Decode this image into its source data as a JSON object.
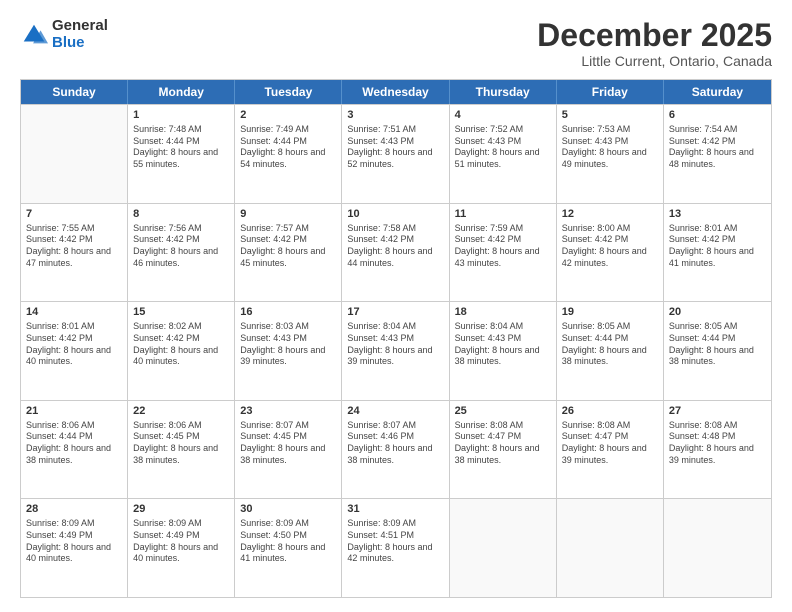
{
  "logo": {
    "general": "General",
    "blue": "Blue"
  },
  "title": {
    "month": "December 2025",
    "location": "Little Current, Ontario, Canada"
  },
  "header_days": [
    "Sunday",
    "Monday",
    "Tuesday",
    "Wednesday",
    "Thursday",
    "Friday",
    "Saturday"
  ],
  "weeks": [
    [
      {
        "day": "",
        "sunrise": "",
        "sunset": "",
        "daylight": ""
      },
      {
        "day": "1",
        "sunrise": "Sunrise: 7:48 AM",
        "sunset": "Sunset: 4:44 PM",
        "daylight": "Daylight: 8 hours and 55 minutes."
      },
      {
        "day": "2",
        "sunrise": "Sunrise: 7:49 AM",
        "sunset": "Sunset: 4:44 PM",
        "daylight": "Daylight: 8 hours and 54 minutes."
      },
      {
        "day": "3",
        "sunrise": "Sunrise: 7:51 AM",
        "sunset": "Sunset: 4:43 PM",
        "daylight": "Daylight: 8 hours and 52 minutes."
      },
      {
        "day": "4",
        "sunrise": "Sunrise: 7:52 AM",
        "sunset": "Sunset: 4:43 PM",
        "daylight": "Daylight: 8 hours and 51 minutes."
      },
      {
        "day": "5",
        "sunrise": "Sunrise: 7:53 AM",
        "sunset": "Sunset: 4:43 PM",
        "daylight": "Daylight: 8 hours and 49 minutes."
      },
      {
        "day": "6",
        "sunrise": "Sunrise: 7:54 AM",
        "sunset": "Sunset: 4:42 PM",
        "daylight": "Daylight: 8 hours and 48 minutes."
      }
    ],
    [
      {
        "day": "7",
        "sunrise": "Sunrise: 7:55 AM",
        "sunset": "Sunset: 4:42 PM",
        "daylight": "Daylight: 8 hours and 47 minutes."
      },
      {
        "day": "8",
        "sunrise": "Sunrise: 7:56 AM",
        "sunset": "Sunset: 4:42 PM",
        "daylight": "Daylight: 8 hours and 46 minutes."
      },
      {
        "day": "9",
        "sunrise": "Sunrise: 7:57 AM",
        "sunset": "Sunset: 4:42 PM",
        "daylight": "Daylight: 8 hours and 45 minutes."
      },
      {
        "day": "10",
        "sunrise": "Sunrise: 7:58 AM",
        "sunset": "Sunset: 4:42 PM",
        "daylight": "Daylight: 8 hours and 44 minutes."
      },
      {
        "day": "11",
        "sunrise": "Sunrise: 7:59 AM",
        "sunset": "Sunset: 4:42 PM",
        "daylight": "Daylight: 8 hours and 43 minutes."
      },
      {
        "day": "12",
        "sunrise": "Sunrise: 8:00 AM",
        "sunset": "Sunset: 4:42 PM",
        "daylight": "Daylight: 8 hours and 42 minutes."
      },
      {
        "day": "13",
        "sunrise": "Sunrise: 8:01 AM",
        "sunset": "Sunset: 4:42 PM",
        "daylight": "Daylight: 8 hours and 41 minutes."
      }
    ],
    [
      {
        "day": "14",
        "sunrise": "Sunrise: 8:01 AM",
        "sunset": "Sunset: 4:42 PM",
        "daylight": "Daylight: 8 hours and 40 minutes."
      },
      {
        "day": "15",
        "sunrise": "Sunrise: 8:02 AM",
        "sunset": "Sunset: 4:42 PM",
        "daylight": "Daylight: 8 hours and 40 minutes."
      },
      {
        "day": "16",
        "sunrise": "Sunrise: 8:03 AM",
        "sunset": "Sunset: 4:43 PM",
        "daylight": "Daylight: 8 hours and 39 minutes."
      },
      {
        "day": "17",
        "sunrise": "Sunrise: 8:04 AM",
        "sunset": "Sunset: 4:43 PM",
        "daylight": "Daylight: 8 hours and 39 minutes."
      },
      {
        "day": "18",
        "sunrise": "Sunrise: 8:04 AM",
        "sunset": "Sunset: 4:43 PM",
        "daylight": "Daylight: 8 hours and 38 minutes."
      },
      {
        "day": "19",
        "sunrise": "Sunrise: 8:05 AM",
        "sunset": "Sunset: 4:44 PM",
        "daylight": "Daylight: 8 hours and 38 minutes."
      },
      {
        "day": "20",
        "sunrise": "Sunrise: 8:05 AM",
        "sunset": "Sunset: 4:44 PM",
        "daylight": "Daylight: 8 hours and 38 minutes."
      }
    ],
    [
      {
        "day": "21",
        "sunrise": "Sunrise: 8:06 AM",
        "sunset": "Sunset: 4:44 PM",
        "daylight": "Daylight: 8 hours and 38 minutes."
      },
      {
        "day": "22",
        "sunrise": "Sunrise: 8:06 AM",
        "sunset": "Sunset: 4:45 PM",
        "daylight": "Daylight: 8 hours and 38 minutes."
      },
      {
        "day": "23",
        "sunrise": "Sunrise: 8:07 AM",
        "sunset": "Sunset: 4:45 PM",
        "daylight": "Daylight: 8 hours and 38 minutes."
      },
      {
        "day": "24",
        "sunrise": "Sunrise: 8:07 AM",
        "sunset": "Sunset: 4:46 PM",
        "daylight": "Daylight: 8 hours and 38 minutes."
      },
      {
        "day": "25",
        "sunrise": "Sunrise: 8:08 AM",
        "sunset": "Sunset: 4:47 PM",
        "daylight": "Daylight: 8 hours and 38 minutes."
      },
      {
        "day": "26",
        "sunrise": "Sunrise: 8:08 AM",
        "sunset": "Sunset: 4:47 PM",
        "daylight": "Daylight: 8 hours and 39 minutes."
      },
      {
        "day": "27",
        "sunrise": "Sunrise: 8:08 AM",
        "sunset": "Sunset: 4:48 PM",
        "daylight": "Daylight: 8 hours and 39 minutes."
      }
    ],
    [
      {
        "day": "28",
        "sunrise": "Sunrise: 8:09 AM",
        "sunset": "Sunset: 4:49 PM",
        "daylight": "Daylight: 8 hours and 40 minutes."
      },
      {
        "day": "29",
        "sunrise": "Sunrise: 8:09 AM",
        "sunset": "Sunset: 4:49 PM",
        "daylight": "Daylight: 8 hours and 40 minutes."
      },
      {
        "day": "30",
        "sunrise": "Sunrise: 8:09 AM",
        "sunset": "Sunset: 4:50 PM",
        "daylight": "Daylight: 8 hours and 41 minutes."
      },
      {
        "day": "31",
        "sunrise": "Sunrise: 8:09 AM",
        "sunset": "Sunset: 4:51 PM",
        "daylight": "Daylight: 8 hours and 42 minutes."
      },
      {
        "day": "",
        "sunrise": "",
        "sunset": "",
        "daylight": ""
      },
      {
        "day": "",
        "sunrise": "",
        "sunset": "",
        "daylight": ""
      },
      {
        "day": "",
        "sunrise": "",
        "sunset": "",
        "daylight": ""
      }
    ]
  ]
}
